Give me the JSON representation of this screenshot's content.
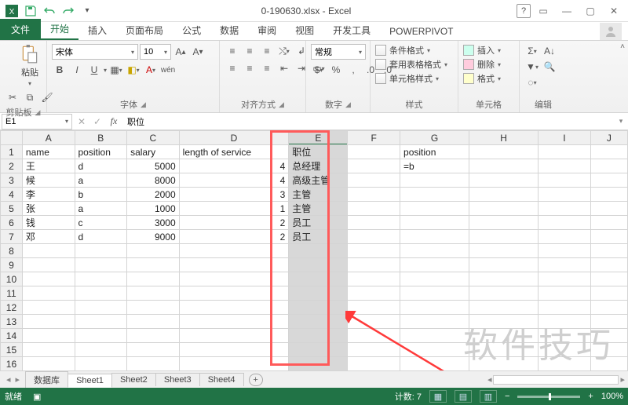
{
  "title": "0-190630.xlsx - Excel",
  "qat": {
    "excel": "excel-icon",
    "save": "save-icon",
    "undo": "undo-icon",
    "redo": "redo-icon",
    "more": "▾"
  },
  "tabs": {
    "file": "文件",
    "items": [
      "开始",
      "插入",
      "页面布局",
      "公式",
      "数据",
      "审阅",
      "视图",
      "开发工具",
      "POWERPIVOT"
    ],
    "active": 0
  },
  "ribbon": {
    "clipboard": {
      "paste": "粘贴",
      "label": "剪贴板"
    },
    "font": {
      "name": "宋体",
      "size": "10",
      "bold": "B",
      "italic": "I",
      "underline": "U",
      "label": "字体"
    },
    "align": {
      "label": "对齐方式"
    },
    "number": {
      "format": "常规",
      "label": "数字"
    },
    "styles": {
      "cond": "条件格式",
      "tbl": "套用表格格式",
      "cell": "单元格样式",
      "label": "样式"
    },
    "cells": {
      "insert": "插入",
      "delete": "删除",
      "format": "格式",
      "label": "单元格"
    },
    "editing": {
      "label": "编辑"
    }
  },
  "namebox": "E1",
  "formula": "职位",
  "columns": [
    "A",
    "B",
    "C",
    "D",
    "E",
    "F",
    "G",
    "H",
    "I",
    "J"
  ],
  "rows": {
    "1": {
      "A": "name",
      "B": "position",
      "C": "salary",
      "D": "length of service",
      "E": "职位",
      "G": "position"
    },
    "2": {
      "A": "王",
      "B": "d",
      "C": "5000",
      "D": "4",
      "E": "总经理",
      "G": "=b"
    },
    "3": {
      "A": "候",
      "B": "a",
      "C": "8000",
      "D": "4",
      "E": "高级主管"
    },
    "4": {
      "A": "李",
      "B": "b",
      "C": "2000",
      "D": "3",
      "E": "主管"
    },
    "5": {
      "A": "张",
      "B": "a",
      "C": "1000",
      "D": "1",
      "E": "主管"
    },
    "6": {
      "A": "钱",
      "B": "c",
      "C": "3000",
      "D": "2",
      "E": "员工"
    },
    "7": {
      "A": "邓",
      "B": "d",
      "C": "9000",
      "D": "2",
      "E": "员工"
    }
  },
  "row_numbers": [
    "1",
    "2",
    "3",
    "4",
    "5",
    "6",
    "7",
    "8",
    "9",
    "10",
    "11",
    "12",
    "13",
    "14",
    "15",
    "16"
  ],
  "sheet_tabs": [
    "数据库",
    "Sheet1",
    "Sheet2",
    "Sheet3",
    "Sheet4"
  ],
  "sheet_active": 1,
  "status": {
    "ready": "就绪",
    "count_label": "计数:",
    "count": "7",
    "zoom": "100%"
  },
  "watermark": "软件技巧"
}
